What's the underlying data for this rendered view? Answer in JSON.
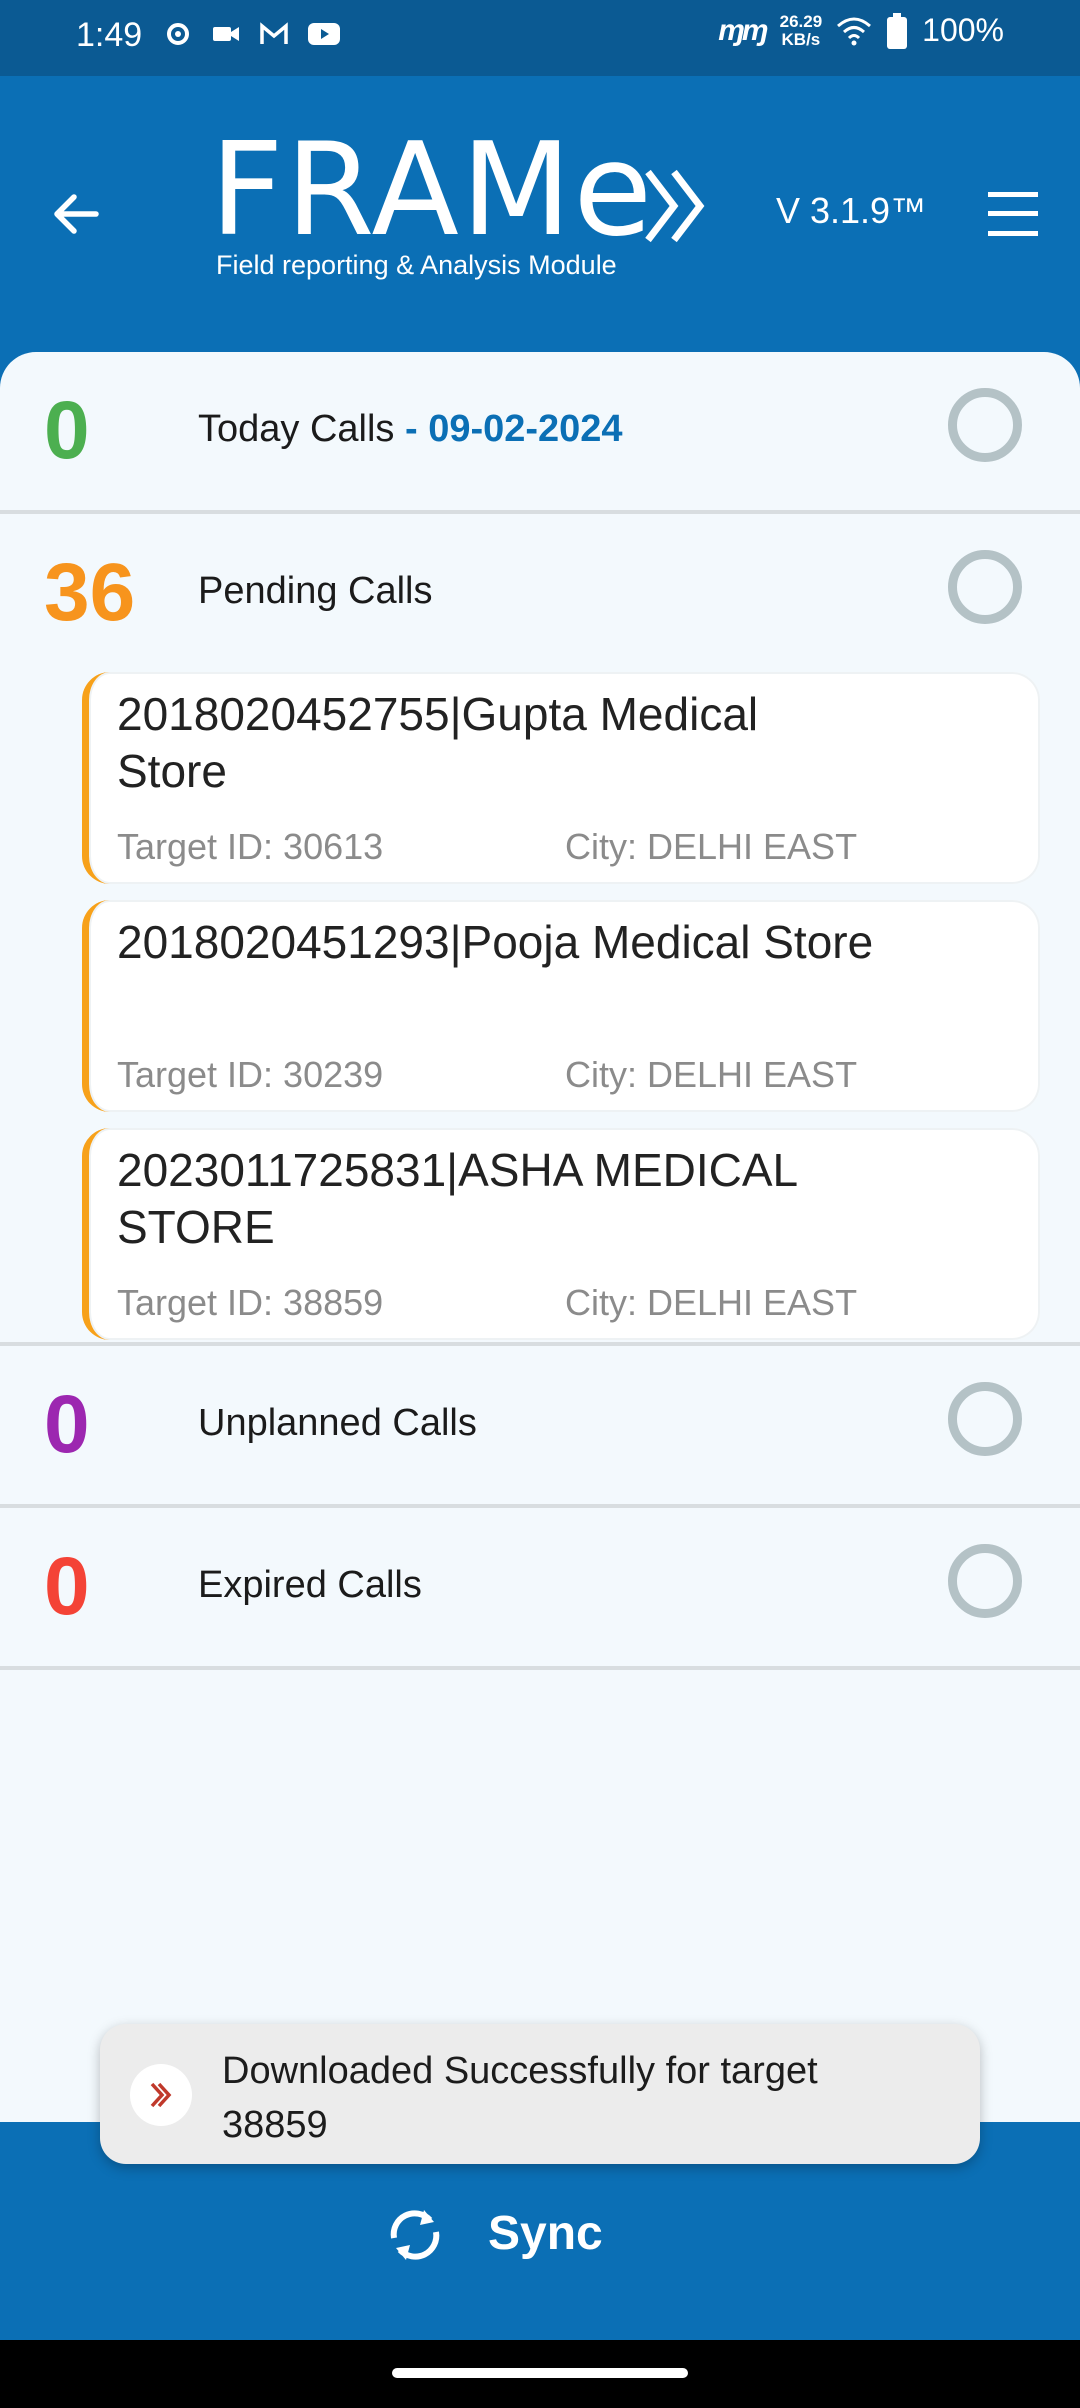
{
  "status_bar": {
    "time": "1:49",
    "net_speed_value": "26.29",
    "net_speed_unit": "KB/s",
    "battery": "100%",
    "icons": [
      "settings-icon",
      "video-icon",
      "gmail-icon",
      "youtube-icon",
      "network-icon",
      "wifi-icon",
      "battery-icon"
    ]
  },
  "header": {
    "logo_title": "FRAMe",
    "logo_subtitle": "Field reporting & Analysis Module",
    "version": "V 3.1.9™",
    "accent": "#0b6fb5"
  },
  "sections": {
    "today": {
      "count": "0",
      "label": "Today Calls",
      "date": " - 09-02-2024",
      "color": "#4caf50"
    },
    "pending": {
      "count": "36",
      "label": "Pending Calls",
      "color": "#f7941d"
    },
    "unplanned": {
      "count": "0",
      "label": "Unplanned Calls",
      "color": "#9c27b0"
    },
    "expired": {
      "count": "0",
      "label": "Expired Calls",
      "color": "#f44336"
    }
  },
  "pending_calls": [
    {
      "title": "2018020452755|Gupta Medical Store",
      "target": "Target ID: 30613",
      "city": "City: DELHI EAST"
    },
    {
      "title": "2018020451293|Pooja Medical Store",
      "target": "Target ID: 30239",
      "city": "City: DELHI EAST"
    },
    {
      "title": "2023011725831|ASHA MEDICAL STORE",
      "target": "Target ID: 38859",
      "city": "City: DELHI EAST"
    }
  ],
  "toast": {
    "message": "Downloaded Successfully for target 38859"
  },
  "footer": {
    "sync_label": "Sync"
  }
}
